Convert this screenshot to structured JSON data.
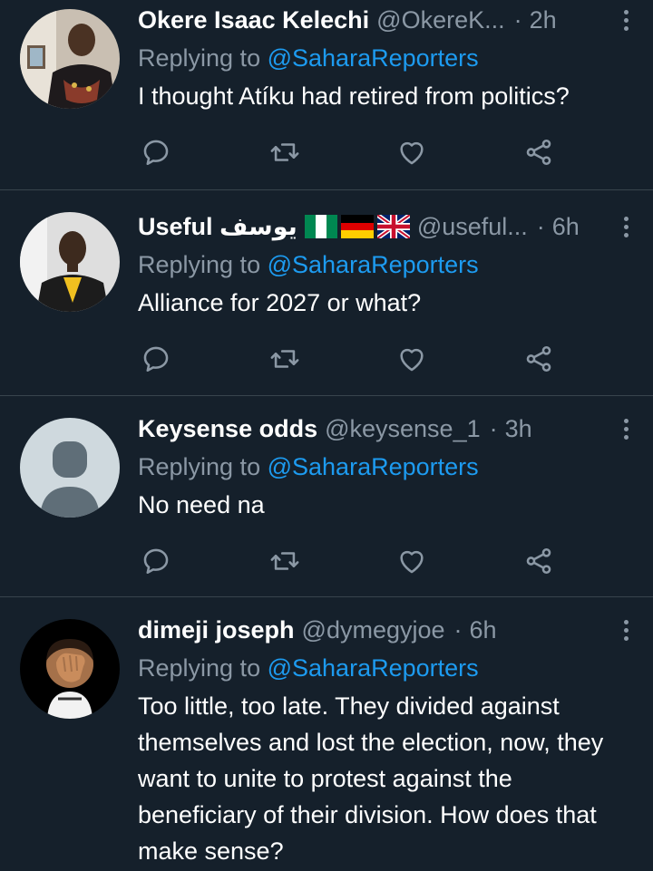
{
  "tweets": [
    {
      "name": "Okere Isaac Kelechi",
      "handle": "@OkereK...",
      "time": "2h",
      "replying_prefix": "Replying to",
      "mention": "@SaharaReporters",
      "text": "I thought Atíku had retired from politics?",
      "avatar": "person-photo"
    },
    {
      "name": "Useful يوسف",
      "flags": [
        "nigeria-flag",
        "germany-flag",
        "uk-flag"
      ],
      "handle": "@useful...",
      "time": "6h",
      "replying_prefix": "Replying to",
      "mention": "@SaharaReporters",
      "text": "Alliance for 2027 or what?",
      "avatar": "person-photo"
    },
    {
      "name": "Keysense odds",
      "handle": "@keysense_1",
      "time": "3h",
      "replying_prefix": "Replying to",
      "mention": "@SaharaReporters",
      "text": "No need na",
      "avatar": "default-profile-icon"
    },
    {
      "name": "dimeji joseph",
      "handle": "@dymegyjoe",
      "time": "6h",
      "replying_prefix": "Replying to",
      "mention": "@SaharaReporters",
      "text": "Too little, too late. They divided against themselves and lost the election, now, they want to unite to protest against the beneficiary of their division. How does that make sense?",
      "avatar": "facepalm-emoji"
    }
  ],
  "separator": "·",
  "icons": [
    "reply-icon",
    "retweet-icon",
    "like-icon",
    "share-icon",
    "more-icon"
  ],
  "colors": {
    "background": "#15202b",
    "secondary_text": "#8b98a5",
    "link": "#1d9bf0",
    "divider": "#38444d"
  }
}
